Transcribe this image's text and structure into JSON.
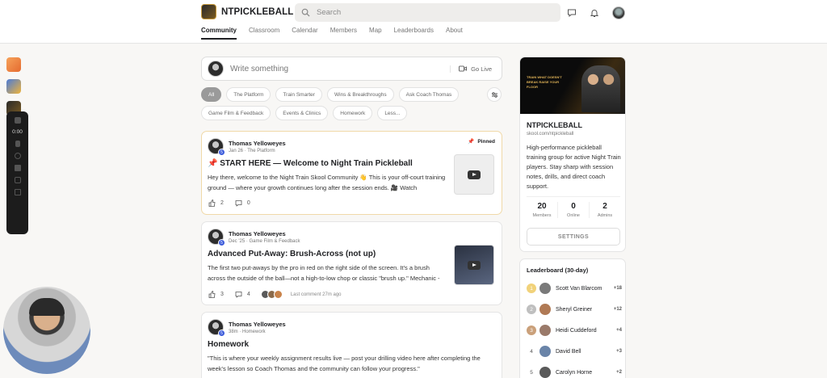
{
  "header": {
    "brand": "NTPICKLEBALL",
    "search_placeholder": "Search",
    "tabs": [
      "Community",
      "Classroom",
      "Calendar",
      "Members",
      "Map",
      "Leaderboards",
      "About"
    ]
  },
  "recorder": {
    "time": "0:00"
  },
  "composer": {
    "placeholder": "Write something",
    "go_live": "Go Live"
  },
  "filters": [
    "All",
    "The Platform",
    "Train Smarter",
    "Wins & Breakthroughs",
    "Ask Coach Thomas",
    "Game Film & Feedback",
    "Events & Clinics",
    "Homework",
    "Less..."
  ],
  "posts": [
    {
      "author": "Thomas Yelloweyes",
      "meta": "Jan 26 · The Platform",
      "pinned_label": "Pinned",
      "title": "📌 START HERE — Welcome to Night Train Pickleball",
      "body": "Hey there, welcome to the Night Train Skool Community 👋 This is your off-court training ground — where your growth continues long after the session ends. 🎥 Watch",
      "likes": "2",
      "comments": "0"
    },
    {
      "author": "Thomas Yelloweyes",
      "meta": "Dec '25 · Game Film & Feedback",
      "title": "Advanced Put-Away: Brush-Across (not up)",
      "body": "The first two put-aways by the pro in red on the right side of the screen. It's a brush across the outside of the ball—not a high-to-low chop or classic \"brush up.\" Mechanic -",
      "likes": "3",
      "comments": "4",
      "last_comment": "Last comment 27m ago"
    },
    {
      "author": "Thomas Yelloweyes",
      "meta": "38m · Homework",
      "title": "Homework",
      "body": "\"This is where your weekly assignment results live — post your drilling video here after completing the week's lesson so Coach Thomas and the community can follow your progress.\""
    }
  ],
  "group": {
    "cover_text": "TRAIN WHAT DOESN'T BREAK RAISE YOUR FLOOR",
    "name": "NTPICKLEBALL",
    "url": "skool.com/ntpickleball",
    "description": "High-performance pickleball training group for active Night Train players. Stay sharp with session notes, drills, and direct coach support.",
    "stats": [
      {
        "value": "20",
        "label": "Members"
      },
      {
        "value": "0",
        "label": "Online"
      },
      {
        "value": "2",
        "label": "Admins"
      }
    ],
    "settings_label": "SETTINGS"
  },
  "leaderboard": {
    "title": "Leaderboard (30-day)",
    "rows": [
      {
        "rank": "1",
        "name": "Scott Van Blarcom",
        "points": "+18"
      },
      {
        "rank": "2",
        "name": "Sheryl Greiner",
        "points": "+12"
      },
      {
        "rank": "3",
        "name": "Heidi Cuddeford",
        "points": "+4"
      },
      {
        "rank": "4",
        "name": "David Bell",
        "points": "+3"
      },
      {
        "rank": "5",
        "name": "Carolyn Horne",
        "points": "+2"
      }
    ]
  }
}
